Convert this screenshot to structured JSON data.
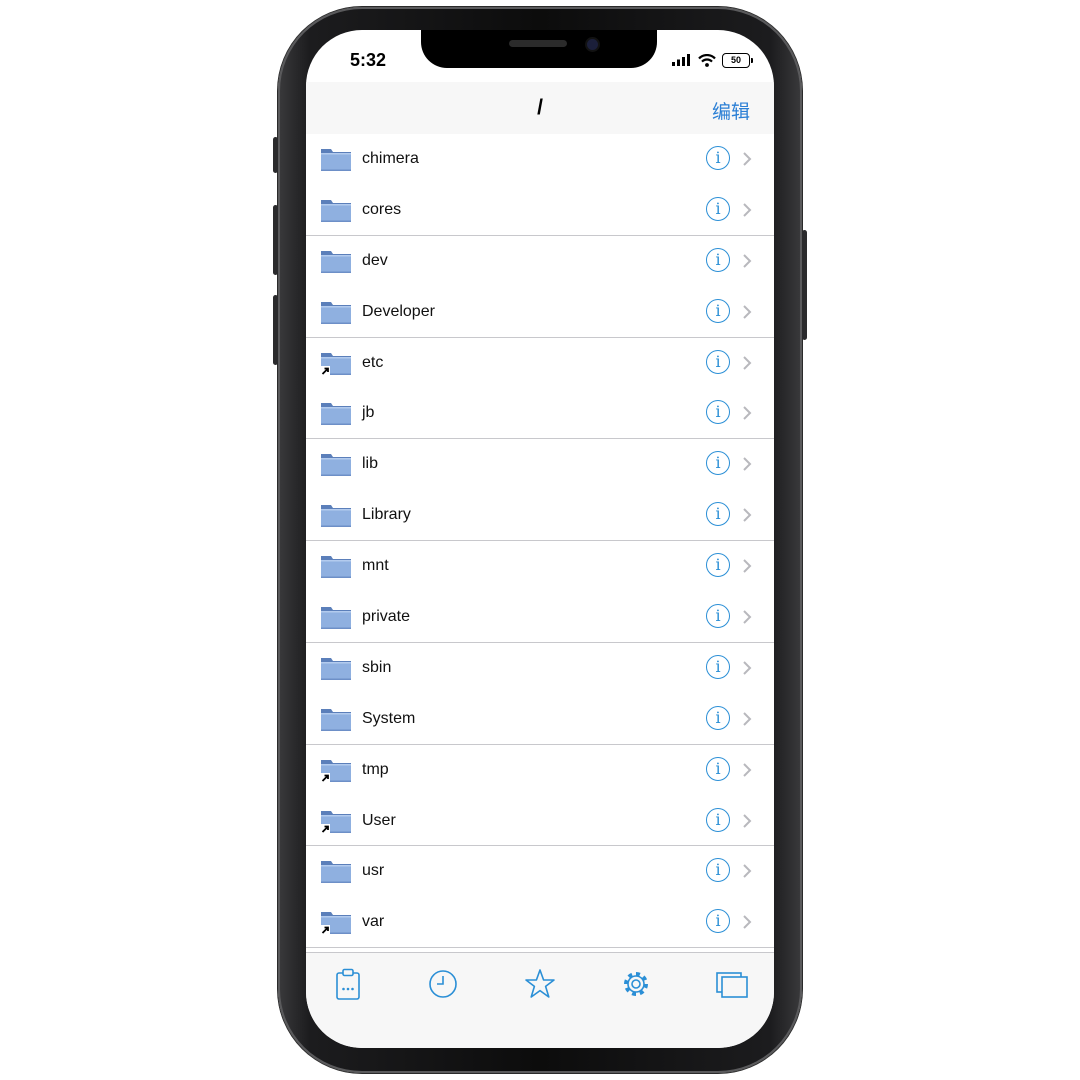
{
  "status_bar": {
    "time": "5:32",
    "battery": "50"
  },
  "navbar": {
    "title": "/",
    "edit_label": "编辑"
  },
  "files": [
    {
      "name": "chimera",
      "symlink": false
    },
    {
      "name": "cores",
      "symlink": false
    },
    {
      "name": "dev",
      "symlink": false
    },
    {
      "name": "Developer",
      "symlink": false
    },
    {
      "name": "etc",
      "symlink": true
    },
    {
      "name": "jb",
      "symlink": false
    },
    {
      "name": "lib",
      "symlink": false
    },
    {
      "name": "Library",
      "symlink": false
    },
    {
      "name": "mnt",
      "symlink": false
    },
    {
      "name": "private",
      "symlink": false
    },
    {
      "name": "sbin",
      "symlink": false
    },
    {
      "name": "System",
      "symlink": false
    },
    {
      "name": "tmp",
      "symlink": true
    },
    {
      "name": "User",
      "symlink": true
    },
    {
      "name": "usr",
      "symlink": false
    },
    {
      "name": "var",
      "symlink": true
    }
  ],
  "tab_bar": [
    {
      "icon": "clipboard-icon"
    },
    {
      "icon": "clock-icon"
    },
    {
      "icon": "star-icon"
    },
    {
      "icon": "gear-icon"
    },
    {
      "icon": "windows-icon"
    }
  ],
  "colors": {
    "accent": "#2b8fd6",
    "folder": "#8fb0e0",
    "separator": "#c8c8cc"
  }
}
